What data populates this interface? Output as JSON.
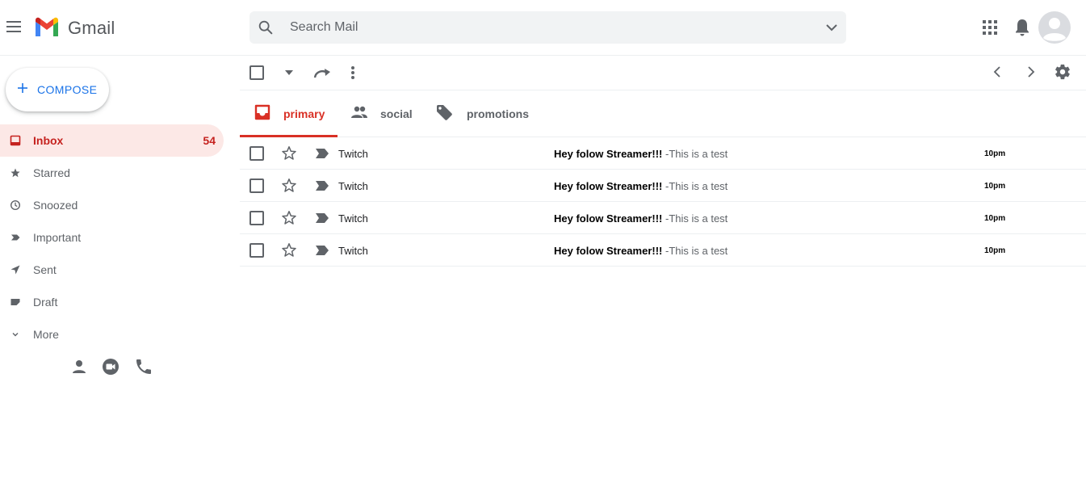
{
  "header": {
    "brand": "Gmail",
    "search_placeholder": "Search Mail"
  },
  "sidebar": {
    "compose_label": "COMPOSE",
    "items": [
      {
        "label": "Inbox",
        "count": "54",
        "icon": "inbox-icon",
        "active": true
      },
      {
        "label": "Starred",
        "count": "",
        "icon": "star-icon"
      },
      {
        "label": "Snoozed",
        "count": "",
        "icon": "clock-icon"
      },
      {
        "label": "Important",
        "count": "",
        "icon": "important-icon"
      },
      {
        "label": "Sent",
        "count": "",
        "icon": "send-icon"
      },
      {
        "label": "Draft",
        "count": "",
        "icon": "draft-icon"
      },
      {
        "label": "More",
        "count": "",
        "icon": "chevron-down-icon"
      }
    ],
    "bottom_icons": [
      "person-icon",
      "video-icon",
      "phone-icon"
    ]
  },
  "toolbar": {
    "icons": [
      "select-all-checkbox",
      "select-dropdown-icon",
      "refresh-icon",
      "more-vert-icon",
      "prev-page-icon",
      "next-page-icon",
      "settings-icon"
    ]
  },
  "tabs": [
    {
      "label": "primary",
      "icon": "inbox-tab-icon",
      "active": true
    },
    {
      "label": "social",
      "icon": "people-icon"
    },
    {
      "label": "promotions",
      "icon": "tag-icon"
    }
  ],
  "emails": [
    {
      "sender": "Twitch",
      "subject": "Hey folow Streamer!!!",
      "snippet": "-This is a test",
      "time": "10pm"
    },
    {
      "sender": "Twitch",
      "subject": "Hey folow Streamer!!!",
      "snippet": "-This is a test",
      "time": "10pm"
    },
    {
      "sender": "Twitch",
      "subject": "Hey folow Streamer!!!",
      "snippet": "-This is a test",
      "time": "10pm"
    },
    {
      "sender": "Twitch",
      "subject": "Hey folow Streamer!!!",
      "snippet": "-This is a test",
      "time": "10pm"
    }
  ],
  "colors": {
    "accent_red": "#d93025",
    "active_bg": "#fce8e6",
    "compose_blue": "#1a73e8",
    "icon_gray": "#5f6368"
  }
}
